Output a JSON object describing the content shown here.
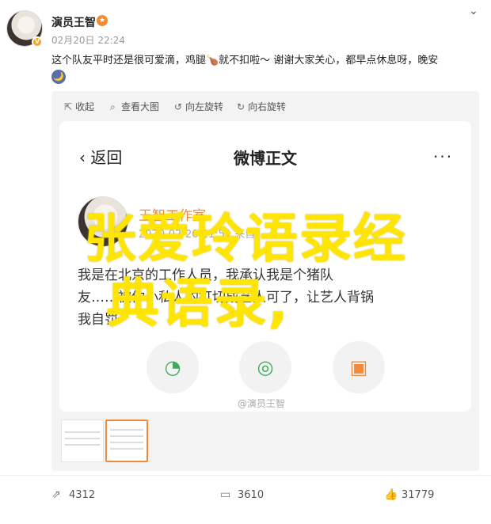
{
  "post": {
    "author": "演员王智",
    "time": "02月20日 22:24",
    "text": "这个队友平时还是很可爱滴，鸡腿🍗就不扣啦～ 谢谢大家关心，都早点休息呀，晚安",
    "emoji": "🌙"
  },
  "toolbar": {
    "collapse": "收起",
    "view_large": "查看大图",
    "rotate_left": "向左旋转",
    "rotate_right": "向右旋转"
  },
  "screenshot": {
    "back": "返回",
    "title": "微博正文",
    "more": "···",
    "inner_name": "王智工作室",
    "inner_time": "2020-02-20 21:51 来自",
    "line1": "我是在北京的工作人员，我承认我是个猪队",
    "line2": "友……被你小私人的打切成艺人可了，让艺人背锅",
    "line3": "我自罚",
    "watermark": "@演员王智"
  },
  "overlay": {
    "line1": "张爱玲语录经",
    "line2": "典语录,"
  },
  "footer": {
    "share_count": "4312",
    "comment_count": "3610",
    "like_count": "31779"
  },
  "icons": {
    "share": "share-icon",
    "comment": "comment-icon",
    "like": "thumbs-up-icon"
  },
  "colors": {
    "accent": "#f18a3a",
    "overlay_text": "#ffe500"
  }
}
